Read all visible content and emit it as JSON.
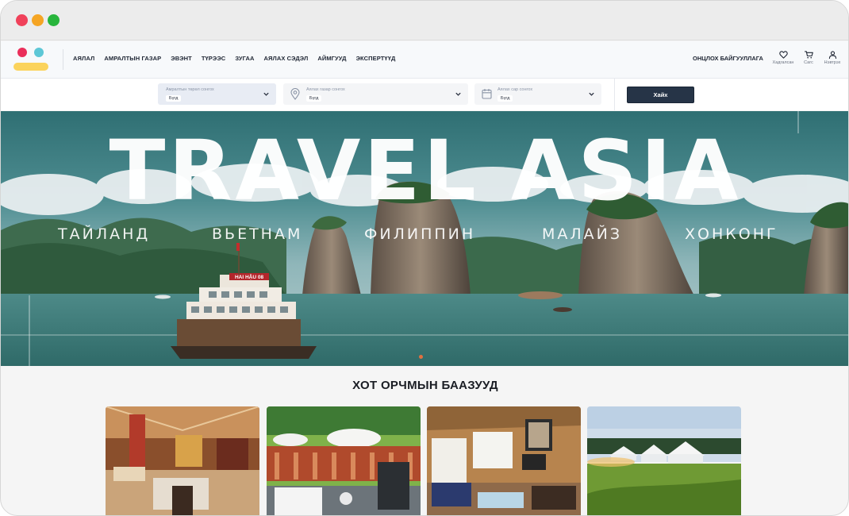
{
  "nav": {
    "items": [
      "АЯЛАЛ",
      "АМРАЛТЫН ГАЗАР",
      "ЭВЭНТ",
      "ТҮРЭЭС",
      "ЗУГАА",
      "АЯЛАХ СЭДЭЛ",
      "АЙМГУУД",
      "ЭКСПЕРТҮҮД"
    ],
    "featured": "ОНЦЛОХ БАЙГУУЛЛАГА",
    "icons": [
      {
        "icon": "heart-icon",
        "label": "Хадгалсан"
      },
      {
        "icon": "cart-icon",
        "label": "Сагс"
      },
      {
        "icon": "user-icon",
        "label": "Нэвтрэх"
      }
    ]
  },
  "search": {
    "type_label": "Амралтын төрөл сонгох",
    "type_value": "Бүгд",
    "place_label": "Аялах газар сонгох",
    "place_value": "Бүгд",
    "date_label": "Аялах сар сонгох",
    "date_value": "Бүгд",
    "button": "Хайх"
  },
  "hero": {
    "title": "TRAVEL ASIA",
    "countries": [
      "ТАЙЛАНД",
      "ВЬЕТНАМ",
      "ФИЛИППИН",
      "МАЛАЙЗ",
      "ХОНКОНГ"
    ],
    "boat_sign": "HAI HẬU 08"
  },
  "section": {
    "title": "ХОТ ОРЧМЫН БААЗУУД"
  },
  "colors": {
    "logo_red": "#ea2f5b",
    "logo_cyan": "#5dc7d6",
    "logo_yellow": "#fbd35c",
    "search_button": "#263447",
    "sea": "#3f7d7a"
  }
}
